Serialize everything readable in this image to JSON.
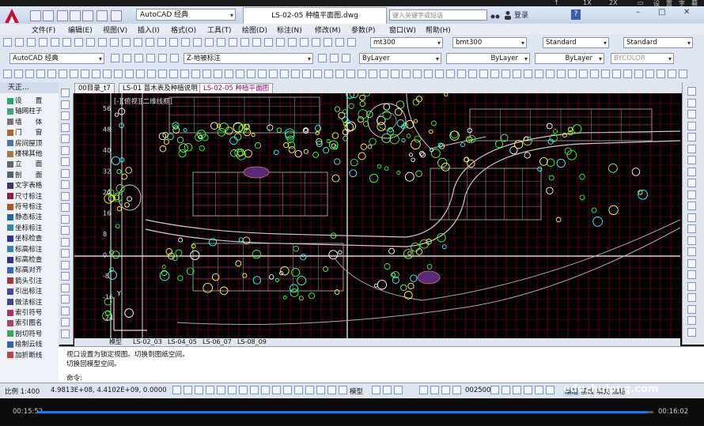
{
  "top_strip": {
    "items": [
      "↑",
      "1X",
      "2X",
      "▭",
      "设",
      "置",
      "字",
      "幕"
    ]
  },
  "title_bar": {
    "workspace": "AutoCAD 经典",
    "document_title": "LS-02-05 种植平面图.dwg",
    "search_placeholder": "键入关键字或短语",
    "login": "登录"
  },
  "menu": [
    "文件(F)",
    "编辑(E)",
    "视图(V)",
    "插入(I)",
    "格式(O)",
    "工具(T)",
    "绘图(D)",
    "标注(N)",
    "修改(M)",
    "参数(P)",
    "窗口(W)",
    "帮助(H)"
  ],
  "toolbar": {
    "text_style": "mt300",
    "dim_style": "bmt300",
    "table_style": "Standard",
    "multileader_style": "Standard",
    "workspace2": "AutoCAD 经典",
    "layer": "Z-地被标注",
    "color": "ByLayer",
    "linetype": "ByLayer",
    "lineweight": "ByLayer",
    "plotstyle": "BYCOLOR"
  },
  "left_panel": {
    "title": "天正...",
    "items": [
      "设　　置",
      "轴网柱子",
      "墙　　体",
      "门　　窗",
      "房间屋顶",
      "楼梯其他",
      "立　　面",
      "剖　　面",
      "文字表格",
      "尺寸标注",
      "符号标注",
      "静态标注",
      "坐标标注",
      "坐标检查",
      "标高标注",
      "标高检查",
      "标高对齐",
      "箭头引注",
      "引出标注",
      "做法标注",
      "索引符号",
      "索引图名",
      "剖切符号",
      "绘制云线",
      "加折断线"
    ]
  },
  "layout_tabs": [
    "00目录_t7",
    "LS-01 苗木表及种植说明",
    "LS-02-05 种植平面图"
  ],
  "viewport_label": "[-][俯视][二维线框]",
  "bottom_tabs": [
    "模型",
    "LS-02_03",
    "LS-04_05",
    "LS-06_07",
    "LS-08_09"
  ],
  "axis_ticks": [
    "56",
    "48",
    "40",
    "32",
    "24",
    "16",
    "8",
    "0",
    "-8",
    "-16",
    "-24"
  ],
  "command_lines": [
    "视口设置为锁定视图。切换到图纸空间。",
    "切换回模型空间。",
    "命令:"
  ],
  "status": {
    "scale": "比例 1:400",
    "coords": "4.9813E+08, 4.4102E+09, 0.0000",
    "model": "模型",
    "dim_scale": "002500",
    "mode1": "编组",
    "mode2": "基线",
    "mode3": "填充",
    "mode4": "加粗"
  },
  "watermark": "eduzhulong.com",
  "player": {
    "current": "00:15:52",
    "total": "00:16:02",
    "progress": 0.99
  }
}
